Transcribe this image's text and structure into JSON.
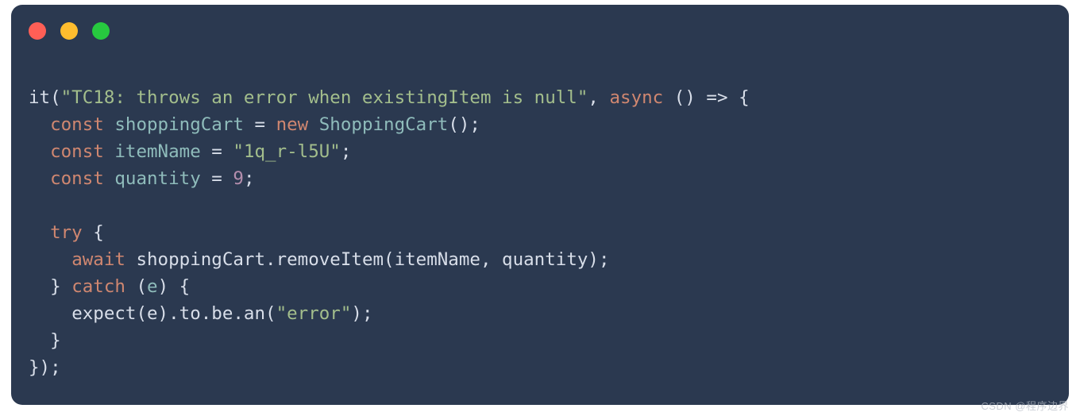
{
  "traffic": {
    "red": "#ff5f56",
    "yellow": "#ffbd2e",
    "green": "#27c93f"
  },
  "code": {
    "l1": {
      "it": "it",
      "op": "(",
      "str": "\"TC18: throws an error when existingItem is null\"",
      "comma": ", ",
      "async": "async",
      "sp": " ",
      "paren": "()",
      "arrow": " => ",
      "brace": "{"
    },
    "l2": {
      "indent": "  ",
      "const": "const",
      "sp": " ",
      "name": "shoppingCart",
      "eq": " = ",
      "new": "new",
      "sp2": " ",
      "ctor": "ShoppingCart",
      "tail": "();"
    },
    "l3": {
      "indent": "  ",
      "const": "const",
      "sp": " ",
      "name": "itemName",
      "eq": " = ",
      "str": "\"1q_r-l5U\"",
      "semi": ";"
    },
    "l4": {
      "indent": "  ",
      "const": "const",
      "sp": " ",
      "name": "quantity",
      "eq": " = ",
      "num": "9",
      "semi": ";"
    },
    "l5": {
      "blank": ""
    },
    "l6": {
      "indent": "  ",
      "try": "try",
      "sp": " ",
      "brace": "{"
    },
    "l7": {
      "indent": "    ",
      "await": "await",
      "sp": " ",
      "call": "shoppingCart.removeItem(itemName, quantity);"
    },
    "l8": {
      "indent": "  ",
      "close": "}",
      "sp": " ",
      "catch": "catch",
      "sp2": " ",
      "op": "(",
      "e": "e",
      "cp": ")",
      "sp3": " ",
      "brace": "{"
    },
    "l9": {
      "indent": "    ",
      "pre": "expect(e).to.be.an(",
      "str": "\"error\"",
      "post": ");"
    },
    "l10": {
      "indent": "  ",
      "close": "}"
    },
    "l11": {
      "close": "});"
    }
  },
  "watermark": "CSDN @程序边界"
}
